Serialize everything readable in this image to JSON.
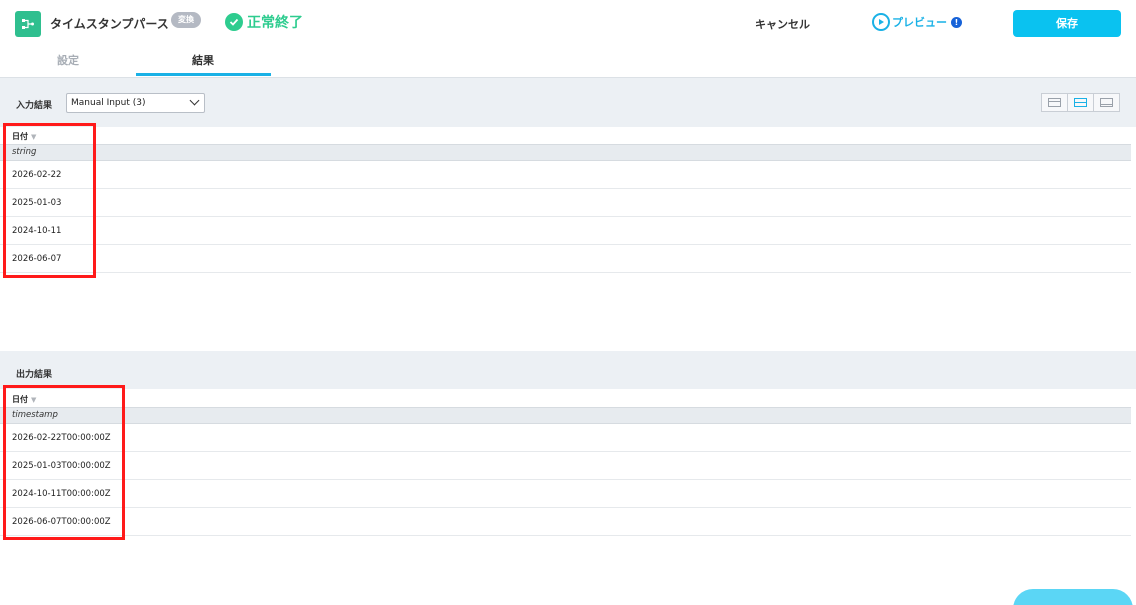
{
  "header": {
    "title": "タイムスタンプパース",
    "badge": "変換",
    "status": "正常終了",
    "cancel_label": "キャンセル",
    "preview_label": "プレビュー",
    "preview_warning": "!",
    "save_label": "保存"
  },
  "tabs": [
    {
      "label": "設定",
      "active": false
    },
    {
      "label": "結果",
      "active": true
    }
  ],
  "input_section": {
    "label": "入力結果",
    "select_value": "Manual Input (3)",
    "column": {
      "name": "日付",
      "type": "string"
    },
    "rows": [
      "2026-02-22",
      "2025-01-03",
      "2024-10-11",
      "2026-06-07"
    ]
  },
  "output_section": {
    "label": "出力結果",
    "column": {
      "name": "日付",
      "type": "timestamp"
    },
    "rows": [
      "2026-02-22T00:00:00Z",
      "2025-01-03T00:00:00Z",
      "2024-10-11T00:00:00Z",
      "2026-06-07T00:00:00Z"
    ]
  },
  "colors": {
    "accent": "#0ac2f0",
    "success": "#2ecc8f",
    "highlight": "#ff1a1a"
  }
}
